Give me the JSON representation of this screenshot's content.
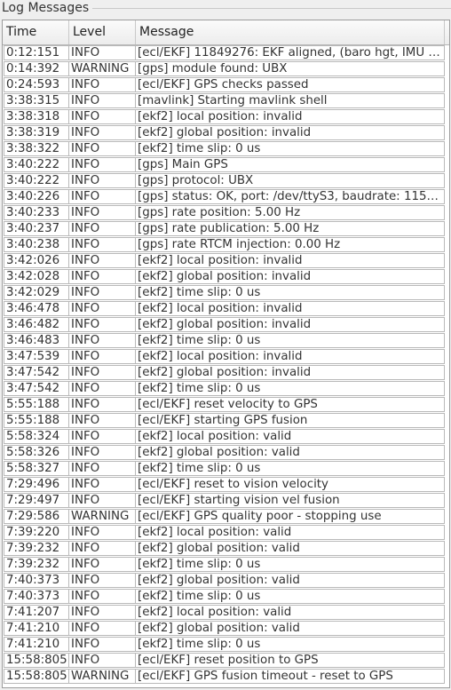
{
  "panel": {
    "title": "Log Messages"
  },
  "columns": {
    "time": "Time",
    "level": "Level",
    "message": "Message"
  },
  "rows": [
    {
      "time": "0:12:151",
      "level": "INFO",
      "message": "[ecl/EKF] 11849276: EKF aligned, (baro hgt, IMU b..."
    },
    {
      "time": "0:14:392",
      "level": "WARNING",
      "message": "[gps] module found: UBX"
    },
    {
      "time": "0:24:593",
      "level": "INFO",
      "message": "[ecl/EKF] GPS checks passed"
    },
    {
      "time": "3:38:315",
      "level": "INFO",
      "message": "[mavlink] Starting mavlink shell"
    },
    {
      "time": "3:38:318",
      "level": "INFO",
      "message": "[ekf2] local position: invalid"
    },
    {
      "time": "3:38:319",
      "level": "INFO",
      "message": "[ekf2] global position: invalid"
    },
    {
      "time": "3:38:322",
      "level": "INFO",
      "message": "[ekf2] time slip: 0 us"
    },
    {
      "time": "3:40:222",
      "level": "INFO",
      "message": "[gps] Main GPS"
    },
    {
      "time": "3:40:222",
      "level": "INFO",
      "message": "[gps] protocol: UBX"
    },
    {
      "time": "3:40:226",
      "level": "INFO",
      "message": "[gps] status: OK, port: /dev/ttyS3, baudrate: 1152..."
    },
    {
      "time": "3:40:233",
      "level": "INFO",
      "message": "[gps] rate position:   5.00 Hz"
    },
    {
      "time": "3:40:237",
      "level": "INFO",
      "message": "[gps] rate publication:  5.00 Hz"
    },
    {
      "time": "3:40:238",
      "level": "INFO",
      "message": "[gps] rate RTCM injection:  0.00 Hz"
    },
    {
      "time": "3:42:026",
      "level": "INFO",
      "message": "[ekf2] local position: invalid"
    },
    {
      "time": "3:42:028",
      "level": "INFO",
      "message": "[ekf2] global position: invalid"
    },
    {
      "time": "3:42:029",
      "level": "INFO",
      "message": "[ekf2] time slip: 0 us"
    },
    {
      "time": "3:46:478",
      "level": "INFO",
      "message": "[ekf2] local position: invalid"
    },
    {
      "time": "3:46:482",
      "level": "INFO",
      "message": "[ekf2] global position: invalid"
    },
    {
      "time": "3:46:483",
      "level": "INFO",
      "message": "[ekf2] time slip: 0 us"
    },
    {
      "time": "3:47:539",
      "level": "INFO",
      "message": "[ekf2] local position: invalid"
    },
    {
      "time": "3:47:542",
      "level": "INFO",
      "message": "[ekf2] global position: invalid"
    },
    {
      "time": "3:47:542",
      "level": "INFO",
      "message": "[ekf2] time slip: 0 us"
    },
    {
      "time": "5:55:188",
      "level": "INFO",
      "message": "[ecl/EKF] reset velocity to GPS"
    },
    {
      "time": "5:55:188",
      "level": "INFO",
      "message": "[ecl/EKF] starting GPS fusion"
    },
    {
      "time": "5:58:324",
      "level": "INFO",
      "message": "[ekf2] local position: valid"
    },
    {
      "time": "5:58:326",
      "level": "INFO",
      "message": "[ekf2] global position: valid"
    },
    {
      "time": "5:58:327",
      "level": "INFO",
      "message": "[ekf2] time slip: 0 us"
    },
    {
      "time": "7:29:496",
      "level": "INFO",
      "message": "[ecl/EKF] reset to vision velocity"
    },
    {
      "time": "7:29:497",
      "level": "INFO",
      "message": "[ecl/EKF] starting vision vel fusion"
    },
    {
      "time": "7:29:586",
      "level": "WARNING",
      "message": "[ecl/EKF] GPS quality poor - stopping use"
    },
    {
      "time": "7:39:220",
      "level": "INFO",
      "message": "[ekf2] local position: valid"
    },
    {
      "time": "7:39:232",
      "level": "INFO",
      "message": "[ekf2] global position: valid"
    },
    {
      "time": "7:39:232",
      "level": "INFO",
      "message": "[ekf2] time slip: 0 us"
    },
    {
      "time": "7:40:373",
      "level": "INFO",
      "message": "[ekf2] global position: valid"
    },
    {
      "time": "7:40:373",
      "level": "INFO",
      "message": "[ekf2] time slip: 0 us"
    },
    {
      "time": "7:41:207",
      "level": "INFO",
      "message": "[ekf2] local position: valid"
    },
    {
      "time": "7:41:210",
      "level": "INFO",
      "message": "[ekf2] global position: valid"
    },
    {
      "time": "7:41:210",
      "level": "INFO",
      "message": "[ekf2] time slip: 0 us"
    },
    {
      "time": "15:58:805",
      "level": "INFO",
      "message": "[ecl/EKF] reset position to GPS"
    },
    {
      "time": "15:58:805",
      "level": "WARNING",
      "message": "[ecl/EKF] GPS fusion timeout - reset to GPS"
    }
  ]
}
